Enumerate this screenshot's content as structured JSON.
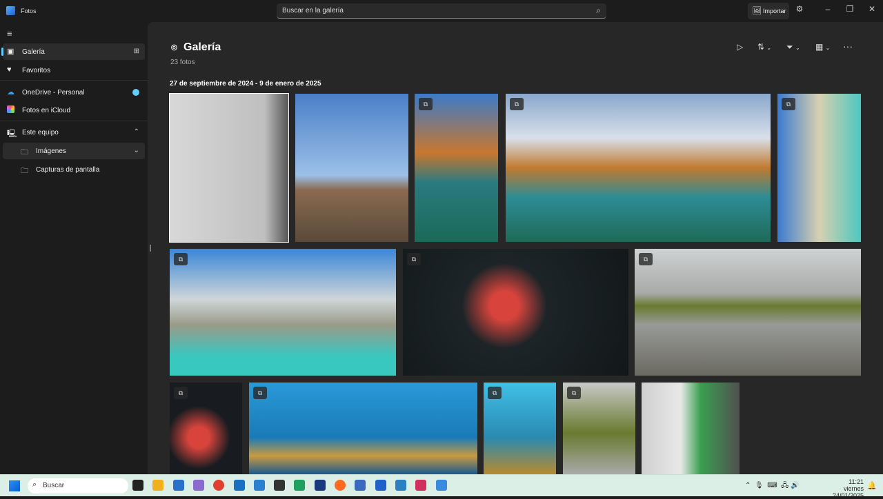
{
  "app": {
    "title": "Fotos",
    "search_placeholder": "Buscar en la galería",
    "import_label": "Importar"
  },
  "sidebar": {
    "items": [
      {
        "label": "Galería",
        "icon": "gallery-icon",
        "selected": true
      },
      {
        "label": "Favoritos",
        "icon": "heart-icon"
      },
      {
        "label": "OneDrive - Personal",
        "icon": "cloud-icon"
      },
      {
        "label": "Fotos en iCloud",
        "icon": "icloud-icon"
      },
      {
        "label": "Este equipo",
        "icon": "computer-icon"
      },
      {
        "label": "Imágenes",
        "icon": "folder-icon"
      },
      {
        "label": "Capturas de pantalla",
        "icon": "folder-icon"
      }
    ]
  },
  "gallery": {
    "title": "Galería",
    "count": "23 fotos",
    "date_range": "27 de septiembre de 2024 - 9 de enero de 2025"
  },
  "taskbar": {
    "search": "Buscar",
    "time": "11:21",
    "date": "viernes 24/01/2025"
  },
  "colors": {
    "accent": "#60cdff",
    "bg": "#272727"
  }
}
